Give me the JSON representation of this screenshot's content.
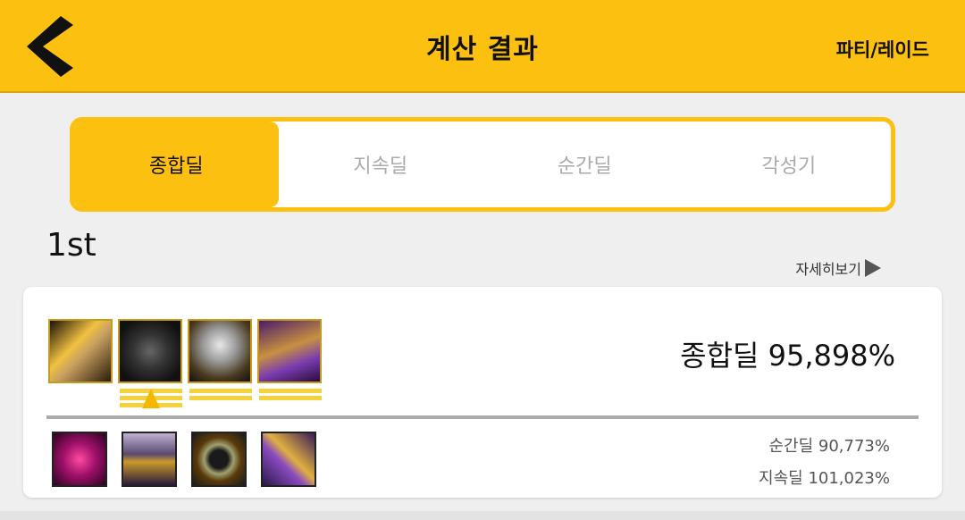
{
  "header": {
    "title": "계산 결과",
    "right_action": "파티/레이드",
    "accent_color": "#fcc010"
  },
  "tabs": [
    {
      "label": "종합딜",
      "active": true
    },
    {
      "label": "지속딜",
      "active": false
    },
    {
      "label": "순간딜",
      "active": false
    },
    {
      "label": "각성기",
      "active": false
    }
  ],
  "result": {
    "rank": "1st",
    "detail_link": "자세히보기",
    "main_stat": "종합딜 95,898%",
    "sub_stats": [
      "순간딜 90,773%",
      "지속딜 101,023%"
    ]
  },
  "icons": {
    "back": "chevron-left-icon",
    "detail_arrow": "play-triangle-icon",
    "items": [
      "weapon-icon",
      "armor-icon",
      "helmet-icon",
      "skill-rune-icon"
    ],
    "sub_items": [
      "rose-orb-icon",
      "pants-icon",
      "ring-icon",
      "weapon-crystal-icon"
    ]
  }
}
